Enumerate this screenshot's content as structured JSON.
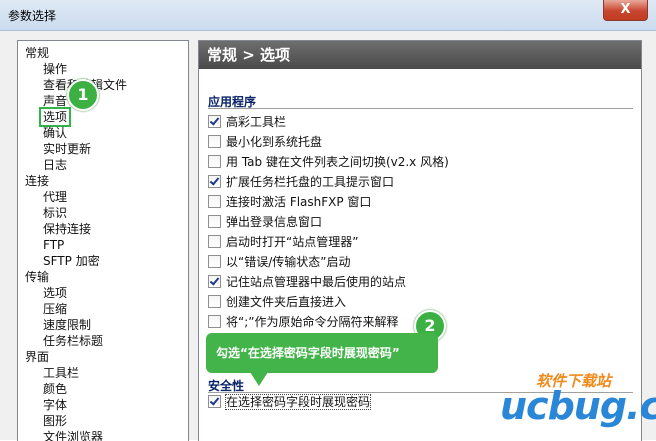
{
  "window": {
    "title": "参数选择",
    "close_label": "X"
  },
  "tree": {
    "items": [
      {
        "label": "常规",
        "level": 0
      },
      {
        "label": "操作",
        "level": 1
      },
      {
        "label": "查看和编辑文件",
        "level": 1
      },
      {
        "label": "声音",
        "level": 1
      },
      {
        "label": "选项",
        "level": 1,
        "selected": true
      },
      {
        "label": "确认",
        "level": 1
      },
      {
        "label": "实时更新",
        "level": 1
      },
      {
        "label": "日志",
        "level": 1
      },
      {
        "label": "连接",
        "level": 0
      },
      {
        "label": "代理",
        "level": 1
      },
      {
        "label": "标识",
        "level": 1
      },
      {
        "label": "保持连接",
        "level": 1
      },
      {
        "label": "FTP",
        "level": 1
      },
      {
        "label": "SFTP 加密",
        "level": 1
      },
      {
        "label": "传输",
        "level": 0
      },
      {
        "label": "选项",
        "level": 1
      },
      {
        "label": "压缩",
        "level": 1
      },
      {
        "label": "速度限制",
        "level": 1
      },
      {
        "label": "任务栏标题",
        "level": 1
      },
      {
        "label": "界面",
        "level": 0
      },
      {
        "label": "工具栏",
        "level": 1
      },
      {
        "label": "颜色",
        "level": 1
      },
      {
        "label": "字体",
        "level": 1
      },
      {
        "label": "图形",
        "level": 1
      },
      {
        "label": "文件浏览器",
        "level": 1
      }
    ]
  },
  "panel": {
    "header": "常规 > 选项",
    "app_section": "应用程序",
    "options": [
      {
        "label": "高彩工具栏",
        "checked": true
      },
      {
        "label": "最小化到系统托盘",
        "checked": false
      },
      {
        "label": "用 Tab 键在文件列表之间切换(v2.x 风格)",
        "checked": false
      },
      {
        "label": "扩展任务栏托盘的工具提示窗口",
        "checked": true
      },
      {
        "label": "连接时激活 FlashFXP 窗口",
        "checked": false
      },
      {
        "label": "弹出登录信息窗口",
        "checked": false
      },
      {
        "label": "启动时打开“站点管理器”",
        "checked": false
      },
      {
        "label": "以“错误/传输状态”启动",
        "checked": false
      },
      {
        "label": "记住站点管理器中最后使用的站点",
        "checked": true
      },
      {
        "label": "创建文件夹后直接进入",
        "checked": false
      },
      {
        "label": "将“;”作为原始命令分隔符来解释",
        "checked": false
      }
    ],
    "security_section": "安全性",
    "security_options": [
      {
        "label": "在选择密码字段时展现密码",
        "checked": true
      }
    ]
  },
  "callouts": {
    "badge1": "1",
    "badge2": "2",
    "tip": "勾选“在选择密码字段时展现密码”"
  },
  "watermark": {
    "top": "软件下载站",
    "main": "ucbug.cc"
  },
  "colors": {
    "accent_green": "#43b449",
    "header_dark": "#4a4a4a",
    "section_blue": "#0a246a"
  }
}
